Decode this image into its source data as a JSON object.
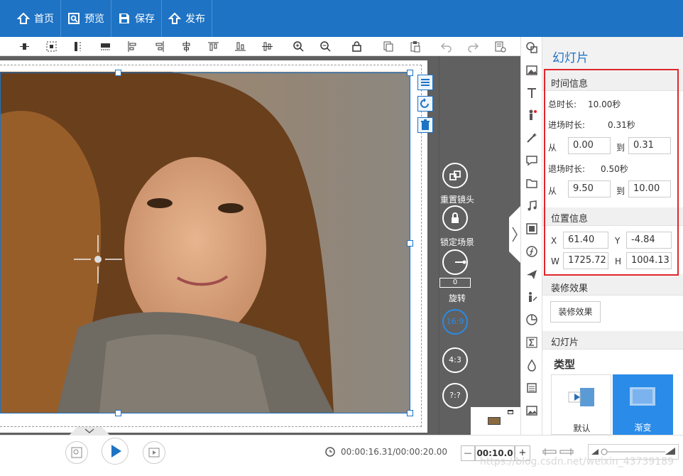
{
  "nav": {
    "home": "首页",
    "preview": "预览",
    "save": "保存",
    "publish": "发布"
  },
  "canvas_controls": {
    "reset_lens": "重置镜头",
    "lock_scene": "锁定场景",
    "rotate_value": "0",
    "rotate": "旋转",
    "ratio_16_9": "16:9",
    "ratio_4_3": "4:3",
    "ratio_custom": "?:?"
  },
  "panel": {
    "title": "幻灯片",
    "time_info": {
      "header": "时间信息",
      "total_label": "总时长:",
      "total_value": "10.00秒",
      "enter_label": "进场时长:",
      "enter_value": "0.31秒",
      "from": "从",
      "to": "到",
      "enter_from": "0.00",
      "enter_to": "0.31",
      "exit_label": "退场时长:",
      "exit_value": "0.50秒",
      "exit_from": "9.50",
      "exit_to": "10.00"
    },
    "position_info": {
      "header": "位置信息",
      "x_label": "X",
      "x_value": "61.40",
      "y_label": "Y",
      "y_value": "-4.84",
      "w_label": "W",
      "w_value": "1725.72",
      "h_label": "H",
      "h_value": "1004.13"
    },
    "decoration": {
      "header": "装修效果",
      "button": "装修效果"
    },
    "slide": {
      "header": "幻灯片",
      "type_label": "类型",
      "type_default": "默认",
      "type_gradient": "渐变"
    }
  },
  "bottom": {
    "time": "00:00:16.31/00:00:20.00",
    "zoom_minus": "—",
    "zoom_value": "00:10.0",
    "zoom_plus": "+"
  },
  "watermark": "https://blog.csdn.net/weixin_43739189",
  "colors": {
    "primary": "#1e73c4",
    "highlight": "#e0262a",
    "selected_card": "#2a8be8"
  }
}
